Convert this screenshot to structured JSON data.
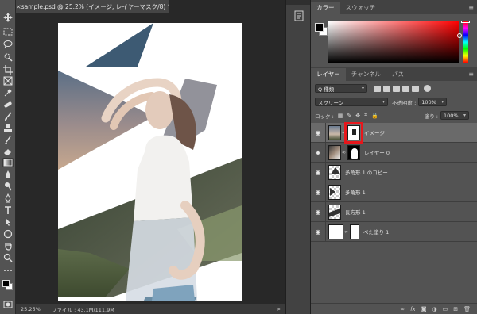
{
  "document": {
    "tab_close": "×",
    "tab_title": "sample.psd @ 25.2% (イメージ, レイヤーマスク/8) *"
  },
  "status": {
    "zoom": "25.25%",
    "file_info": "ファイル : 43.1M/111.9M",
    "arrow": ">"
  },
  "color_panel": {
    "tabs": [
      "カラー",
      "スウォッチ"
    ],
    "menu": "≡",
    "foreground": "#000000",
    "background": "#ffffff"
  },
  "layers_panel": {
    "tabs": [
      "レイヤー",
      "チャンネル",
      "パス"
    ],
    "menu": "≡",
    "filter_kind": "Q 種類",
    "blend_mode": "スクリーン",
    "opacity_label": "不透明度 :",
    "opacity_value": "100%",
    "lock_label": "ロック :",
    "fill_label": "塗り :",
    "fill_value": "100%",
    "layers": [
      {
        "name": "イメージ",
        "visible": true,
        "selected": true
      },
      {
        "name": "レイヤー 0",
        "visible": true,
        "selected": false
      },
      {
        "name": "多角形 1 のコピー",
        "visible": true,
        "selected": false
      },
      {
        "name": "多角形 1",
        "visible": true,
        "selected": false
      },
      {
        "name": "長方形 1",
        "visible": true,
        "selected": false
      },
      {
        "name": "べた塗り 1",
        "visible": true,
        "selected": false
      }
    ],
    "footer_buttons": [
      "link-icon",
      "fx-icon",
      "mask-icon",
      "adjustment-icon",
      "group-icon",
      "new-layer-icon",
      "trash-icon"
    ]
  },
  "colors": {
    "highlight_box": "#e8161b",
    "triangle": "#3d5a73",
    "panel_bg": "#535353"
  }
}
